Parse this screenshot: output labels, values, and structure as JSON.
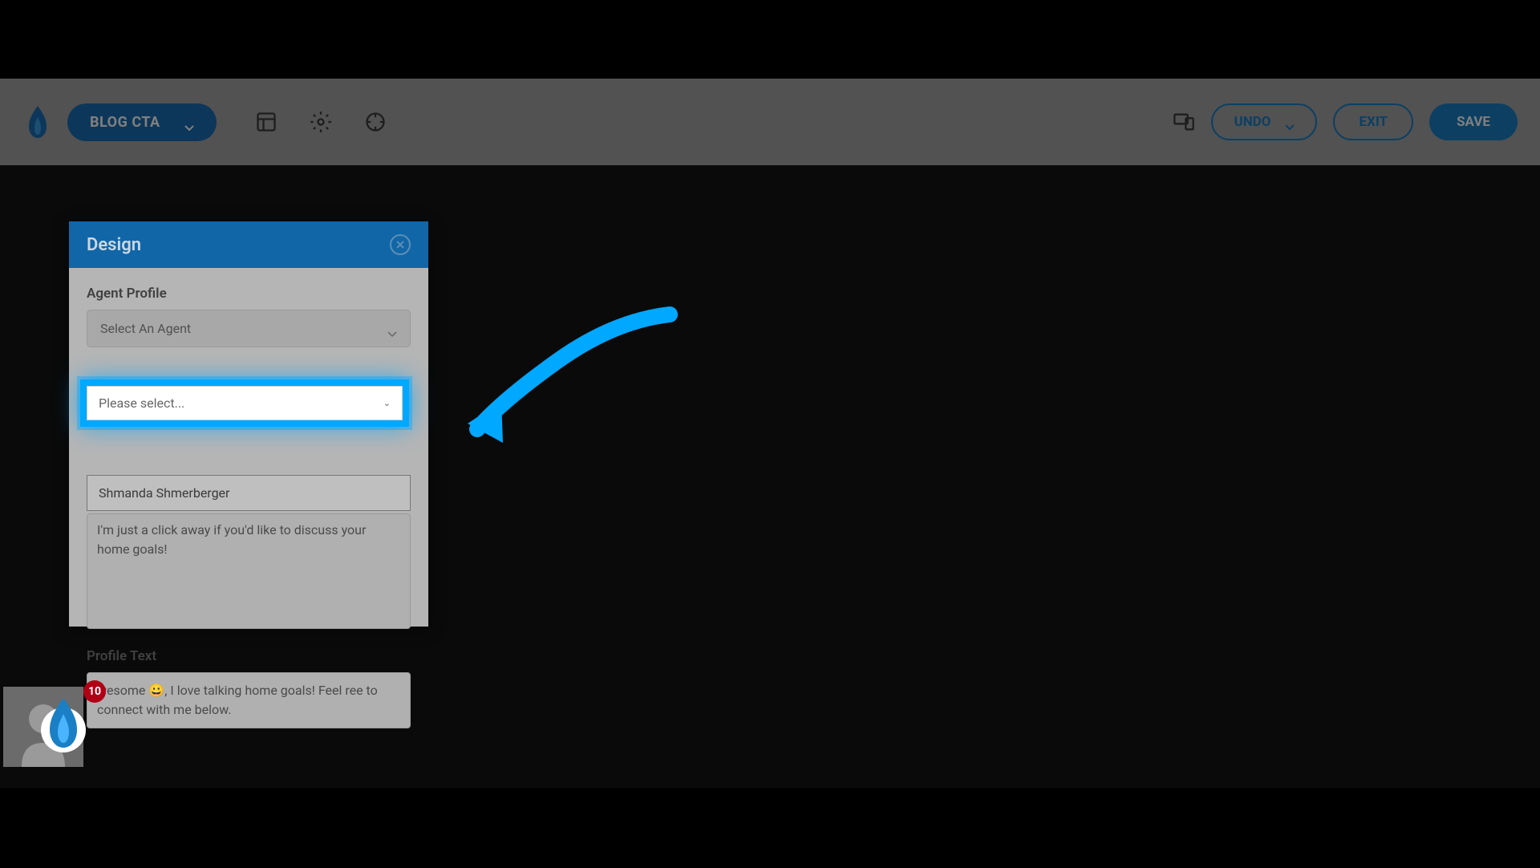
{
  "toolbar": {
    "blog_cta_label": "BLOG CTA",
    "undo_label": "UNDO",
    "exit_label": "EXIT",
    "save_label": "SAVE"
  },
  "panel": {
    "title": "Design",
    "agent_profile_label": "Agent Profile",
    "select_agent_placeholder": "Select An Agent",
    "please_select_placeholder": "Please select...",
    "dropdown_option_1": "Shmanda Shmerberger",
    "message_text": "I'm just a click away if you'd like to discuss your home goals!",
    "profile_text_label": "Profile Text",
    "profile_text_value": "wesome 😀, I love talking home goals! Feel ree to connect with me below."
  },
  "badge": {
    "count": "10"
  },
  "colors": {
    "accent": "#00a8ff",
    "toolbar_blue": "#1a7fc4",
    "panel_header": "#1166a8",
    "badge_red": "#b00015"
  }
}
